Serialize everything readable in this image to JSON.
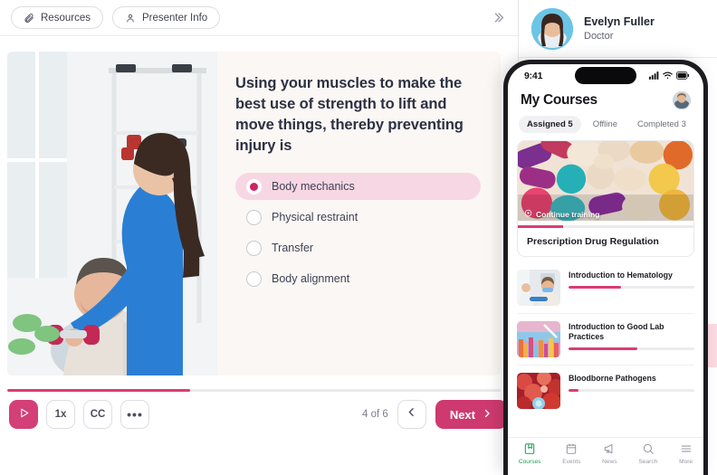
{
  "topbar": {
    "resources_label": "Resources",
    "presenter_info_label": "Presenter Info",
    "collapse_icon": "chevrons-right-icon"
  },
  "slide": {
    "question": "Using your muscles to make the best use of strength to lift and move things, thereby preventing injury is",
    "photo_alt": "physical-therapist-assisting-patient-with-dumbbell",
    "options": [
      {
        "label": "Body mechanics",
        "selected": true
      },
      {
        "label": "Physical restraint",
        "selected": false
      },
      {
        "label": "Transfer",
        "selected": false
      },
      {
        "label": "Body alignment",
        "selected": false
      }
    ]
  },
  "player": {
    "progress_percent": 37,
    "play_label": "play-icon",
    "speed_label": "1x",
    "captions_label": "CC",
    "more_label": "•••",
    "page_count": "4 of 6",
    "prev_label": "chevron-left-icon",
    "next_label": "Next"
  },
  "presenter": {
    "name": "Evelyn Fuller",
    "role": "Doctor",
    "avatar_alt": "evelyn-fuller-portrait"
  },
  "phone": {
    "status": {
      "time": "9:41",
      "cellular": "signal-icon",
      "wifi": "wifi-icon",
      "battery": "battery-icon"
    },
    "title": "My Courses",
    "avatar_alt": "user-portrait",
    "tabs": [
      {
        "label": "Assigned 5",
        "active": true
      },
      {
        "label": "Offline",
        "active": false
      },
      {
        "label": "Completed 3",
        "active": false
      }
    ],
    "featured_card": {
      "badge": "Continue training",
      "badge_icon": "play-circle-icon",
      "title": "Prescription Drug Regulation",
      "progress_percent": 26,
      "image_alt": "assorted-pills-capsules"
    },
    "courses": [
      {
        "title": "Introduction to Hematology",
        "progress_percent": 42,
        "image_alt": "blood-draw-clinic"
      },
      {
        "title": "Introduction to Good Lab Practices",
        "progress_percent": 55,
        "image_alt": "colorful-lab-abstract"
      },
      {
        "title": "Bloodborne Pathogens",
        "progress_percent": 8,
        "image_alt": "red-blood-cells"
      }
    ],
    "tabbar": [
      {
        "label": "Courses",
        "icon": "book-icon",
        "active": true
      },
      {
        "label": "Events",
        "icon": "calendar-icon",
        "active": false
      },
      {
        "label": "News",
        "icon": "megaphone-icon",
        "active": false
      },
      {
        "label": "Search",
        "icon": "search-icon",
        "active": false
      },
      {
        "label": "More",
        "icon": "menu-icon",
        "active": false
      }
    ]
  },
  "colors": {
    "accent_pink": "#D33F76",
    "selected_row": "#F7D7E3",
    "slide_bg": "#FBF7F4",
    "nav_active_green": "#1A9E55"
  }
}
